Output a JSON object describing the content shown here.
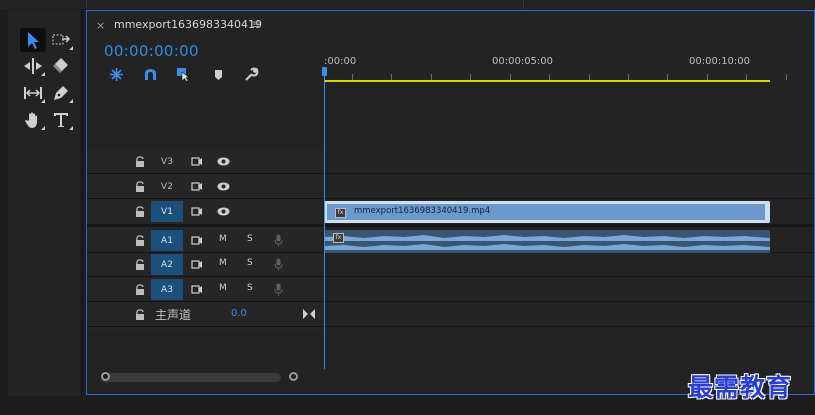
{
  "tab": {
    "close": "×",
    "title": "mmexport1636983340419",
    "menu": "≡"
  },
  "timecode": "00:00:00:00",
  "controls": [
    "nest-sequence-icon",
    "snap-icon",
    "linked-selection-icon",
    "add-marker-icon",
    "timeline-settings-icon"
  ],
  "tools": [
    "selection-tool-icon",
    "track-select-tool-icon",
    "ripple-edit-tool-icon",
    "razor-tool-icon",
    "slip-tool-icon",
    "pen-tool-icon",
    "hand-tool-icon",
    "type-tool-icon"
  ],
  "ruler": {
    "labels": [
      ":00:00",
      "00:00:05:00",
      "00:00:10:00"
    ]
  },
  "tracks": {
    "video": [
      {
        "name": "V3",
        "targeted": false
      },
      {
        "name": "V2",
        "targeted": false
      },
      {
        "name": "V1",
        "targeted": true
      }
    ],
    "audio": [
      {
        "name": "A1",
        "targeted": true,
        "mute": "M",
        "solo": "S"
      },
      {
        "name": "A2",
        "targeted": true,
        "mute": "M",
        "solo": "S"
      },
      {
        "name": "A3",
        "targeted": true,
        "mute": "M",
        "solo": "S"
      }
    ],
    "master": {
      "label": "主声道",
      "value": "0.0"
    }
  },
  "clips": {
    "video": {
      "name": "mmexport1636983340419.mp4",
      "fx": "fx"
    },
    "audio": {
      "fx": "fx"
    }
  },
  "colors": {
    "accent": "#2d8ceb",
    "target": "#1d4f7c",
    "workbar": "#d9d300",
    "video_clip": "#6c98cb",
    "audio_clip": "#3a5571"
  },
  "watermark": "最需教育"
}
